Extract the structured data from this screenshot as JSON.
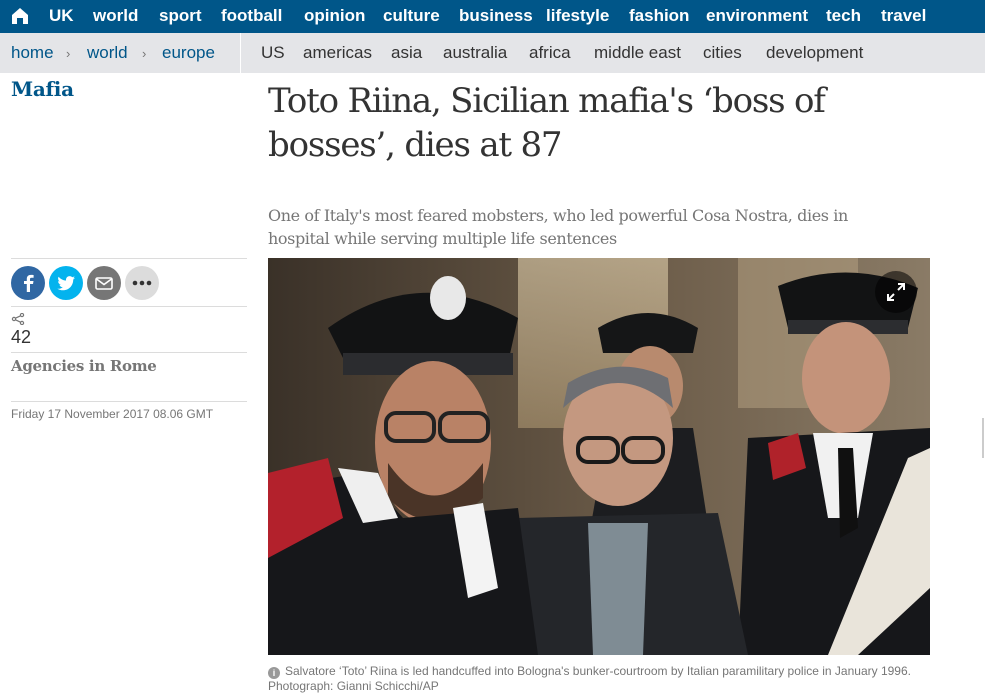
{
  "topnav": {
    "items": [
      {
        "label": "UK"
      },
      {
        "label": "world"
      },
      {
        "label": "sport"
      },
      {
        "label": "football"
      },
      {
        "label": "opinion"
      },
      {
        "label": "culture"
      },
      {
        "label": "business"
      },
      {
        "label": "lifestyle"
      },
      {
        "label": "fashion"
      },
      {
        "label": "environment"
      },
      {
        "label": "tech"
      },
      {
        "label": "travel"
      }
    ],
    "home_icon": "home-icon"
  },
  "subnav": {
    "breadcrumbs": [
      {
        "label": "home"
      },
      {
        "label": "world"
      },
      {
        "label": "europe"
      }
    ],
    "separator": "›",
    "links": [
      {
        "label": "US"
      },
      {
        "label": "americas"
      },
      {
        "label": "asia"
      },
      {
        "label": "australia"
      },
      {
        "label": "africa"
      },
      {
        "label": "middle east"
      },
      {
        "label": "cities"
      },
      {
        "label": "development"
      }
    ]
  },
  "article": {
    "section": "Mafia",
    "headline": "Toto Riina, Sicilian mafia's ‘boss of bosses’, dies at 87",
    "standfirst": "One of Italy's most feared mobsters, who led powerful Cosa Nostra, dies in hospital while serving multiple life sentences",
    "share_count": "42",
    "byline": "Agencies in Rome",
    "dateline": "Friday 17 November 2017 08.06 GMT",
    "caption": "Salvatore ‘Toto’ Riina is led handcuffed into Bologna's bunker-courtroom by Italian paramilitary police in January 1996. Photograph: Gianni Schicchi/AP"
  },
  "share_buttons": [
    {
      "icon": "facebook-icon",
      "color": "#3067a3"
    },
    {
      "icon": "twitter-icon",
      "color": "#03b3ee"
    },
    {
      "icon": "email-icon",
      "color": "#767676"
    },
    {
      "icon": "more-icon",
      "color": "#dcdcdc"
    }
  ],
  "colors": {
    "brand": "#005689",
    "subnav_bg": "#e4e5e8",
    "text": "#333333",
    "muted": "#767676"
  }
}
